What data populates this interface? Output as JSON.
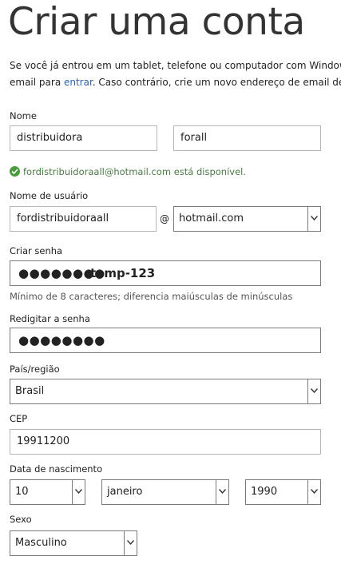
{
  "header": {
    "title": "Criar uma conta",
    "intro_line1": "Se você já entrou em um tablet, telefone ou computador com Windows",
    "intro_line2_prefix": "email para ",
    "intro_line2_link": "entrar",
    "intro_line2_suffix": ". Caso contrário, crie um novo endereço de email de"
  },
  "name": {
    "label": "Nome",
    "first_value": "distribuidora",
    "last_value": "forall"
  },
  "availability": {
    "text": "fordistribuidoraall@hotmail.com está disponível."
  },
  "username": {
    "label": "Nome de usuário",
    "value": "fordistribuidoraall",
    "at_symbol": "@",
    "domain_value": "hotmail.com"
  },
  "password": {
    "label": "Criar senha",
    "masked_value": "●●●●●●●●",
    "overlay_text": "temp-123",
    "hint": "Mínimo de 8 caracteres; diferencia maiúsculas de minúsculas"
  },
  "confirm_password": {
    "label": "Redigitar a senha",
    "masked_value": "●●●●●●●●"
  },
  "country": {
    "label": "País/região",
    "value": "Brasil"
  },
  "zip": {
    "label": "CEP",
    "value": "19911200"
  },
  "birthdate": {
    "label": "Data de nascimento",
    "day": "10",
    "month": "janeiro",
    "year": "1990"
  },
  "gender": {
    "label": "Sexo",
    "value": "Masculino"
  }
}
